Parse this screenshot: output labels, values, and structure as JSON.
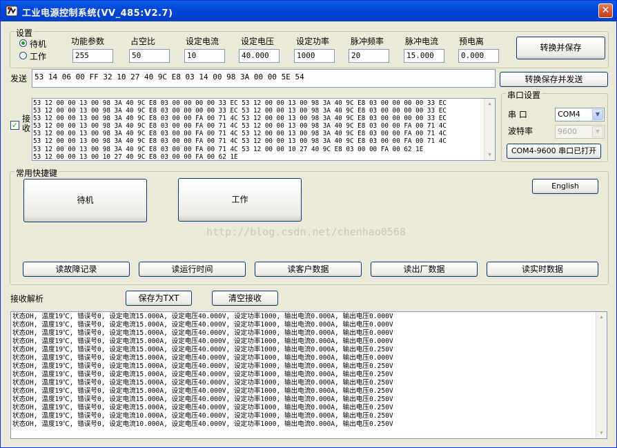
{
  "window": {
    "title": "工业电源控制系统(VV_485:V2.7)",
    "close_glyph": "✕"
  },
  "settings": {
    "group_label": "设置",
    "mode_standby": "待机",
    "mode_work": "工作",
    "selected_mode": "standby",
    "fields": [
      {
        "label": "功能参数",
        "value": "255"
      },
      {
        "label": "占空比",
        "value": "50"
      },
      {
        "label": "设定电流",
        "value": "10"
      },
      {
        "label": "设定电压",
        "value": "40.000"
      },
      {
        "label": "设定功率",
        "value": "1000"
      },
      {
        "label": "脉冲频率",
        "value": "20"
      },
      {
        "label": "脉冲电流",
        "value": "15.000"
      },
      {
        "label": "预电离",
        "value": "0.000"
      }
    ],
    "convert_save_label": "转换并保存"
  },
  "send": {
    "label": "发送",
    "value": "53 14 06 00 FF 32 10 27 40 9C E8 03 14 00 98 3A 00 00 5E 54",
    "button_label": "转换保存并发送"
  },
  "receive": {
    "label": "接收",
    "checked": true,
    "lines": [
      "53 12 00 00 13 00 98 3A 40 9C E8 03 00 00 00 00 33 EC 53 12 00 00 13 00 98 3A 40 9C E8 03 00 00 00 00 33 EC",
      "53 12 00 00 13 00 98 3A 40 9C E8 03 00 00 00 00 33 EC 53 12 00 00 13 00 98 3A 40 9C E8 03 00 00 00 00 33 EC",
      "53 12 00 00 13 00 98 3A 40 9C E8 03 00 00 FA 00 71 4C 53 12 00 00 13 00 98 3A 40 9C E8 03 00 00 00 00 33 EC",
      "53 12 00 00 13 00 98 3A 40 9C E8 03 00 00 FA 00 71 4C 53 12 00 00 13 00 98 3A 40 9C E8 03 00 00 FA 00 71 4C",
      "53 12 00 00 13 00 98 3A 40 9C E8 03 00 00 FA 00 71 4C 53 12 00 00 13 00 98 3A 40 9C E8 03 00 00 FA 00 71 4C",
      "53 12 00 00 13 00 98 3A 40 9C E8 03 00 00 FA 00 71 4C 53 12 00 00 13 00 98 3A 40 9C E8 03 00 00 FA 00 71 4C",
      "53 12 00 00 13 00 98 3A 40 9C E8 03 00 00 FA 00 71 4C 53 12 00 00 10 27 40 9C E8 03 00 00 FA 00 62 1E",
      "53 12 00 00 13 00 10 27 40 9C E8 03 00 00 FA 00 62 1E"
    ]
  },
  "serial": {
    "group_label": "串口设置",
    "port_label": "串  口",
    "port_value": "COM4",
    "baud_label": "波特率",
    "baud_value": "9600",
    "status_button": "COM4-9600 串口已打开"
  },
  "shortcuts": {
    "group_label": "常用快捷键",
    "standby_label": "待机",
    "work_label": "工作",
    "english_label": "English",
    "read_buttons": [
      "读故障记录",
      "读运行时间",
      "读客户数据",
      "读出厂数据",
      "读实时数据"
    ]
  },
  "watermark": "http://blog.csdn.net/chenhao0568",
  "parse": {
    "label": "接收解析",
    "save_txt_label": "保存为TXT",
    "clear_label": "清空接收",
    "lines": [
      "状态OH, 温度19℃, 错误号0, 设定电流15.000A, 设定电压40.000V, 设定功率1000, 输出电流0.000A, 输出电压0.000V",
      "状态OH, 温度19℃, 错误号0, 设定电流15.000A, 设定电压40.000V, 设定功率1000, 输出电流0.000A, 输出电压0.000V",
      "状态OH, 温度19℃, 错误号0, 设定电流15.000A, 设定电压40.000V, 设定功率1000, 输出电流0.000A, 输出电压0.000V",
      "状态OH, 温度19℃, 错误号0, 设定电流15.000A, 设定电压40.000V, 设定功率1000, 输出电流0.000A, 输出电压0.000V",
      "状态OH, 温度19℃, 错误号0, 设定电流15.000A, 设定电压40.000V, 设定功率1000, 输出电流0.000A, 输出电压0.250V",
      "状态OH, 温度19℃, 错误号0, 设定电流15.000A, 设定电压40.000V, 设定功率1000, 输出电流0.000A, 输出电压0.000V",
      "状态OH, 温度19℃, 错误号0, 设定电流15.000A, 设定电压40.000V, 设定功率1000, 输出电流0.000A, 输出电压0.250V",
      "状态OH, 温度19℃, 错误号0, 设定电流15.000A, 设定电压40.000V, 设定功率1000, 输出电流0.000A, 输出电压0.250V",
      "状态OH, 温度19℃, 错误号0, 设定电流15.000A, 设定电压40.000V, 设定功率1000, 输出电流0.000A, 输出电压0.250V",
      "状态OH, 温度19℃, 错误号0, 设定电流15.000A, 设定电压40.000V, 设定功率1000, 输出电流0.000A, 输出电压0.250V",
      "状态OH, 温度19℃, 错误号0, 设定电流15.000A, 设定电压40.000V, 设定功率1000, 输出电流0.000A, 输出电压0.250V",
      "状态OH, 温度19℃, 错误号0, 设定电流15.000A, 设定电压40.000V, 设定功率1000, 输出电流0.000A, 输出电压0.250V",
      "状态OH, 温度19℃, 错误号0, 设定电流10.000A, 设定电压40.000V, 设定功率1000, 输出电流0.000A, 输出电压0.250V",
      "状态OH, 温度19℃, 错误号0, 设定电流10.000A, 设定电压40.000V, 设定功率1000, 输出电流0.000A, 输出电压0.250V"
    ]
  }
}
